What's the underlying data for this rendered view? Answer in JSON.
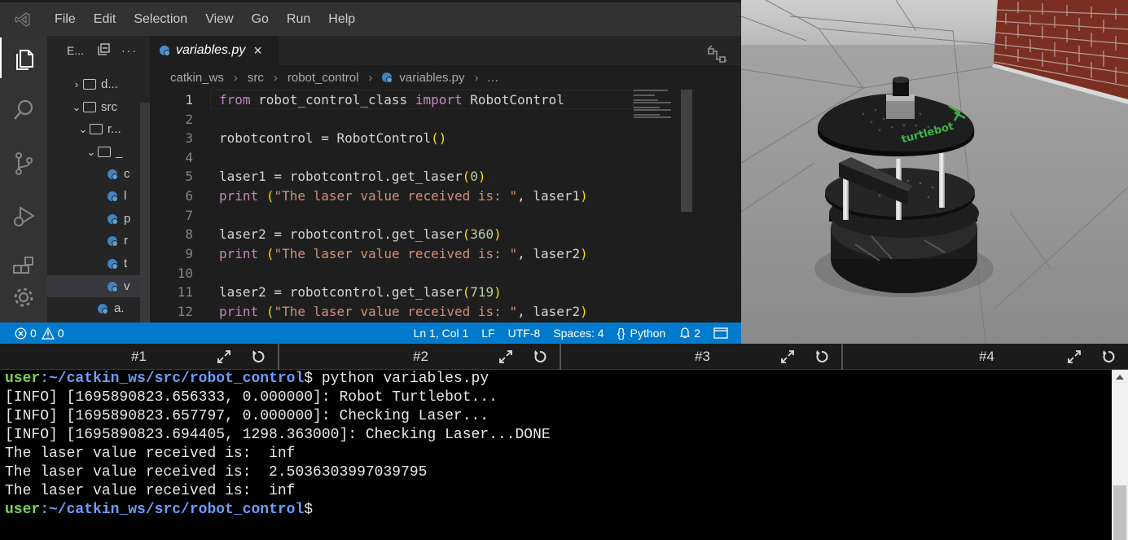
{
  "menu": [
    "File",
    "Edit",
    "Selection",
    "View",
    "Go",
    "Run",
    "Help"
  ],
  "explorer": {
    "title": "E...",
    "items": [
      {
        "label": "d..."
      },
      {
        "label": "src"
      },
      {
        "label": "r..."
      },
      {
        "label": "_"
      },
      {
        "label": "c"
      },
      {
        "label": "l"
      },
      {
        "label": "p"
      },
      {
        "label": "r"
      },
      {
        "label": "t"
      },
      {
        "label": "v"
      },
      {
        "label": "a."
      }
    ]
  },
  "tab": {
    "label": "variables.py",
    "close": "×"
  },
  "breadcrumb": [
    "catkin_ws",
    "src",
    "robot_control",
    "variables.py",
    "…"
  ],
  "code": {
    "line_numbers": [
      "1",
      "2",
      "3",
      "4",
      "5",
      "6",
      "7",
      "8",
      "9",
      "10",
      "11",
      "12"
    ],
    "l1": {
      "kw1": "from",
      "mod": " robot_control_class ",
      "kw2": "import",
      "cls": " RobotControl"
    },
    "l3": {
      "a": "robotcontrol = RobotControl",
      "p": "()"
    },
    "l5": {
      "a": "laser1 = robotcontrol.get_laser",
      "p1": "(",
      "n": "0",
      "p2": ")"
    },
    "l6": {
      "pr": "print",
      "sp": " ",
      "p1": "(",
      "s": "\"The laser value received is: \"",
      "rest": ", laser1",
      "p2": ")"
    },
    "l8": {
      "a": "laser2 = robotcontrol.get_laser",
      "p1": "(",
      "n": "360",
      "p2": ")"
    },
    "l9": {
      "pr": "print",
      "sp": " ",
      "p1": "(",
      "s": "\"The laser value received is: \"",
      "rest": ", laser2",
      "p2": ")"
    },
    "l11": {
      "a": "laser2 = robotcontrol.get_laser",
      "p1": "(",
      "n": "719",
      "p2": ")"
    },
    "l12": {
      "pr": "print",
      "sp": " ",
      "p1": "(",
      "s": "\"The laser value received is: \"",
      "rest": ", laser2",
      "p2": ")"
    }
  },
  "status": {
    "errors": "0",
    "warnings": "0",
    "position": "Ln 1, Col 1",
    "eol": "LF",
    "encoding": "UTF-8",
    "spaces": "Spaces: 4",
    "language": "Python",
    "notifications": "2"
  },
  "terminal_tabs": [
    "#1",
    "#2",
    "#3",
    "#4"
  ],
  "terminal": {
    "user": "user",
    "path": ":~/catkin_ws/src/robot_control",
    "cmd": "$ python variables.py",
    "lines": [
      "[INFO] [1695890823.656333, 0.000000]: Robot Turtlebot...",
      "[INFO] [1695890823.657797, 0.000000]: Checking Laser...",
      "[INFO] [1695890823.694405, 1298.363000]: Checking Laser...DONE",
      "The laser value received is:  inf",
      "The laser value received is:  2.5036303997039795",
      "The laser value received is:  inf"
    ],
    "prompt_end": "$"
  },
  "gazebo": {
    "robot_label": "turtlebot"
  }
}
